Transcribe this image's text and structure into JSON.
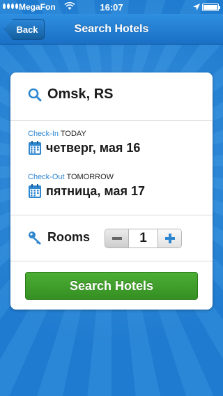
{
  "status_bar": {
    "carrier": "MegaFon",
    "time": "16:07"
  },
  "nav": {
    "back_label": "Back",
    "title": "Search Hotels"
  },
  "search": {
    "city": "Omsk, RS"
  },
  "check_in": {
    "label": "Check-In",
    "relative": "TODAY",
    "date": "четверг, мая 16"
  },
  "check_out": {
    "label": "Check-Out",
    "relative": "TOMORROW",
    "date": "пятница, мая 17"
  },
  "rooms": {
    "label": "Rooms",
    "value": "1"
  },
  "search_button": {
    "label": "Search Hotels"
  },
  "icons": {
    "search": "search-icon",
    "calendar": "calendar-icon",
    "key": "key-icon",
    "minus": "minus-icon",
    "plus": "plus-icon",
    "wifi": "wifi-icon",
    "location": "location-arrow-icon",
    "battery": "battery-icon"
  },
  "colors": {
    "accent_blue": "#2e86cf",
    "nav_blue": "#1a6fc4",
    "search_green": "#3f9f2b",
    "background_blue": "#1f7bcf"
  }
}
